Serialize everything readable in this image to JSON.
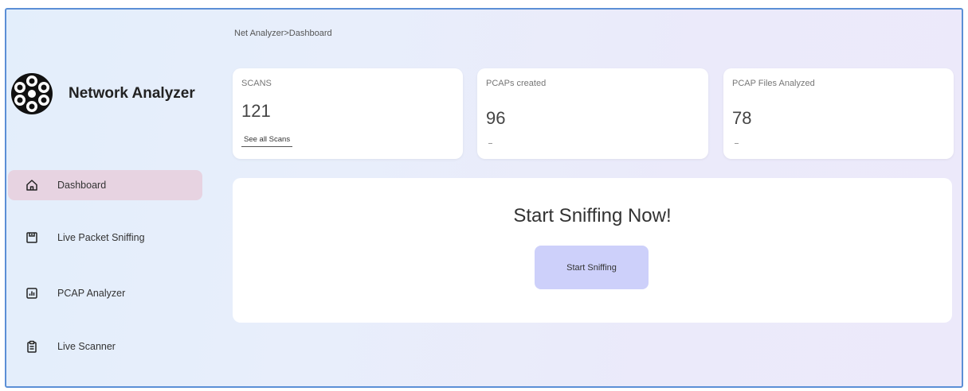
{
  "app": {
    "name": "Network Analyzer",
    "logo_icon": "film-reel-icon"
  },
  "breadcrumb": "Net Analyzer>Dashboard",
  "sidebar": {
    "items": [
      {
        "label": "Dashboard",
        "icon": "home-icon",
        "active": true
      },
      {
        "label": "Live Packet Sniffing",
        "icon": "save-icon",
        "active": false
      },
      {
        "label": "PCAP Analyzer",
        "icon": "bar-chart-icon",
        "active": false
      },
      {
        "label": "Live Scanner",
        "icon": "clipboard-icon",
        "active": false
      }
    ]
  },
  "cards": [
    {
      "title": "SCANS",
      "value": "121",
      "link": "See all Scans"
    },
    {
      "title": "PCAPs created",
      "value": "96",
      "footer": "-"
    },
    {
      "title": "PCAP Files Analyzed",
      "value": "78",
      "footer": "-"
    }
  ],
  "cta": {
    "title": "Start Sniffing Now!",
    "button": "Start Sniffing"
  },
  "colors": {
    "active_nav": "#e7d3e1",
    "cta_button": "#cdd0fa",
    "border": "#5b8fd6"
  }
}
